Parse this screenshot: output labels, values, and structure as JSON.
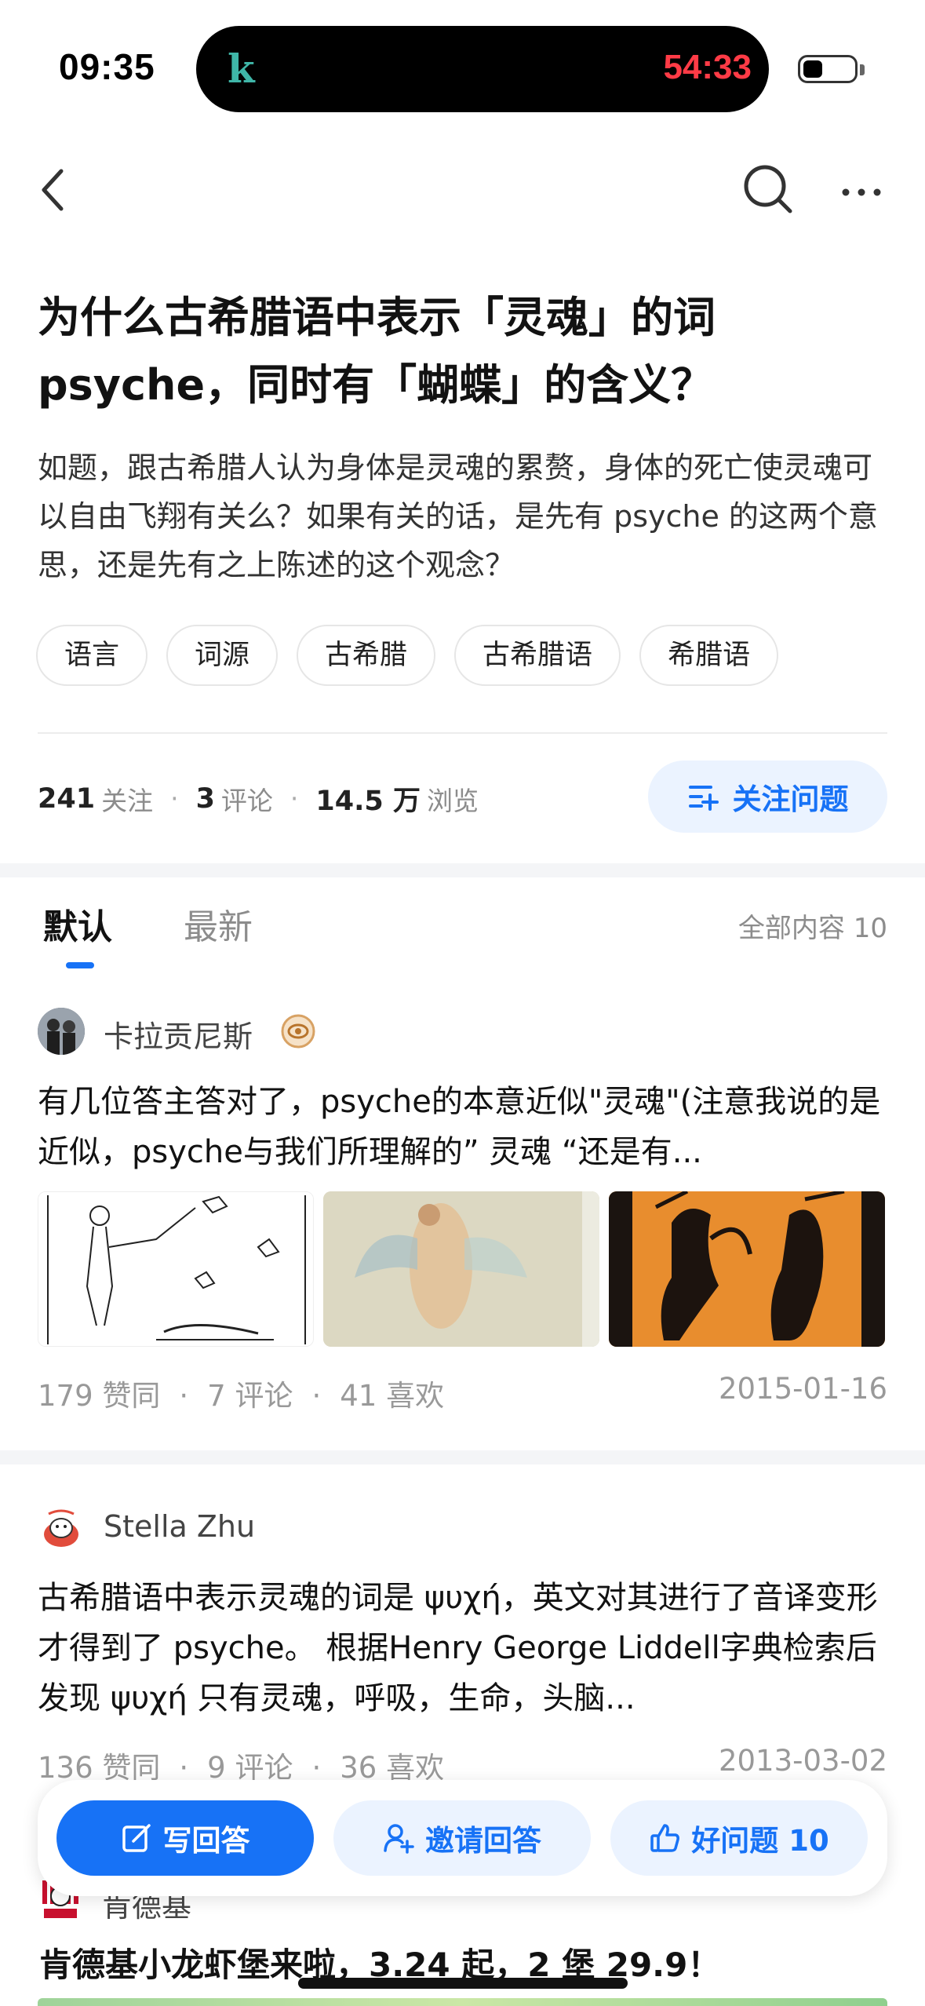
{
  "status_bar": {
    "time": "09:35",
    "timer": "54:33",
    "island_app_logo": "k-logo"
  },
  "nav": {
    "back_icon": "chevron-left-icon",
    "search_icon": "search-icon",
    "more_icon": "more-dots-icon"
  },
  "question": {
    "title": "为什么古希腊语中表示「灵魂」的词 psyche，同时有「蝴蝶」的含义？",
    "description": "如题，跟古希腊人认为身体是灵魂的累赘，身体的死亡使灵魂可以自由飞翔有关么？如果有关的话，是先有 psyche 的这两个意思，还是先有之上陈述的这个观念？",
    "tags": [
      "语言",
      "词源",
      "古希腊",
      "古希腊语",
      "希腊语"
    ],
    "stats": {
      "followers": "241",
      "followers_label": "关注",
      "comments": "3",
      "comments_label": "评论",
      "views": "14.5 万",
      "views_label": "浏览"
    },
    "follow_button": "关注问题"
  },
  "tabs": {
    "default": "默认",
    "latest": "最新",
    "all_count": "全部内容 10"
  },
  "answers": [
    {
      "author": "卡拉贡尼斯",
      "text": "有几位答主答对了，psyche的本意近似\"灵魂\"(注意我说的是近似，psyche与我们所理解的” 灵魂 “还是有...",
      "meta": {
        "likes": "179 赞同",
        "comments": "7 评论",
        "favs": "41 喜欢"
      },
      "date": "2015-01-16"
    },
    {
      "author": "Stella Zhu",
      "text": "古希腊语中表示灵魂的词是 ψυχή，英文对其进行了音译变形才得到了 psyche。 根据Henry George Liddell字典检索后发现 ψυχή 只有灵魂，呼吸，生命，头脑...",
      "meta": {
        "likes": "136 赞同",
        "comments": "9 评论",
        "favs": "36 喜欢"
      },
      "date": "2013-03-02"
    }
  ],
  "actions": {
    "write": "写回答",
    "invite": "邀请回答",
    "good": "好问题 10"
  },
  "ad": {
    "brand": "肯德基",
    "title": "肯德基小龙虾堡来啦，3.24 起，2 堡 29.9！"
  },
  "colors": {
    "accent": "#1772f6",
    "accent_light": "#ebf3ff",
    "timer_red": "#ff3b46"
  }
}
